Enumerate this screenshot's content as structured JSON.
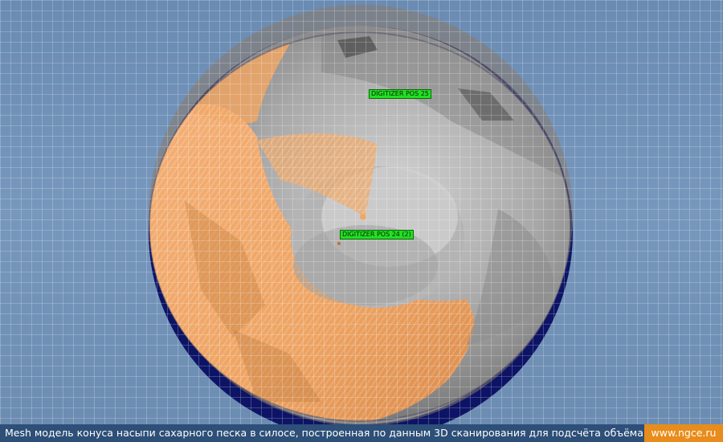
{
  "scene": {
    "description_colors": {
      "background": "#6f8fb4",
      "grid": "#ffffff",
      "silo_ring": "#0d1466",
      "sugar_surface": "#f2a865",
      "scan_gray": "#a9a9a9"
    },
    "labels": {
      "pos25": "DIGITIZER POS 25",
      "pos24": "DIGITIZER POS 24 (2)"
    }
  },
  "footer": {
    "caption": "Mesh модель конуса насыпи сахарного песка в силосе, построенная по данным 3D сканирования для подсчёта объёма",
    "site": "www.ngce.ru",
    "accent": "#e88c1b",
    "bar_color": "#2d4f78"
  }
}
